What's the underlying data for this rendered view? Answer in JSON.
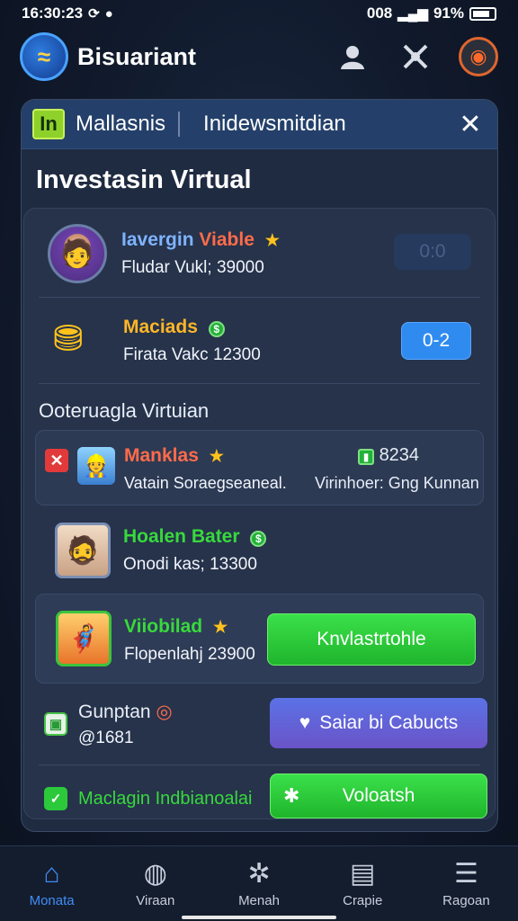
{
  "status": {
    "time": "16:30:23",
    "right_text": "008",
    "battery_text": "91%"
  },
  "app": {
    "title": "Bisuariant"
  },
  "dialog": {
    "tab_primary": "Mallasnis",
    "tab_secondary": "Inidewsmitdian",
    "badge": "In",
    "section_title": "Investasin Virtual",
    "item1": {
      "name": "Iavergin",
      "name_accent": "Viable",
      "sub": "Fludar Vukl; 39000",
      "button": "0:0"
    },
    "item2": {
      "name": "Maciads",
      "sub": "Firata Vakc 12300",
      "button": "0-2"
    },
    "subsection_title": "Ooteruagla Virtuian",
    "item3": {
      "name": "Manklas",
      "value": "8234",
      "sub_left": "Vatain Soraegseaneal.",
      "sub_right": "Virinhoer: Gng Kunnan"
    },
    "item4": {
      "name": "Hoalen Bater",
      "sub": "Onodi kas; 13300"
    },
    "item5": {
      "name": "Viiobilad",
      "sub": "Flopenlahj 23900",
      "button": "Knvlastrtohle"
    },
    "item6": {
      "name": "Gunptan",
      "sub": "@1681",
      "button": "Saiar bi Cabucts"
    },
    "item7": {
      "name": "Maclagin Indbianoalai",
      "button": "Voloatsh"
    }
  },
  "nav": {
    "items": [
      {
        "label": "Monata",
        "icon": "home-icon"
      },
      {
        "label": "Viraan",
        "icon": "map-icon"
      },
      {
        "label": "Menah",
        "icon": "star-icon"
      },
      {
        "label": "Crapie",
        "icon": "cards-icon"
      },
      {
        "label": "Ragoan",
        "icon": "list-icon"
      }
    ]
  },
  "colors": {
    "accent_blue": "#3f8df6",
    "accent_green": "#2cc93a",
    "accent_gold": "#ffb627"
  }
}
